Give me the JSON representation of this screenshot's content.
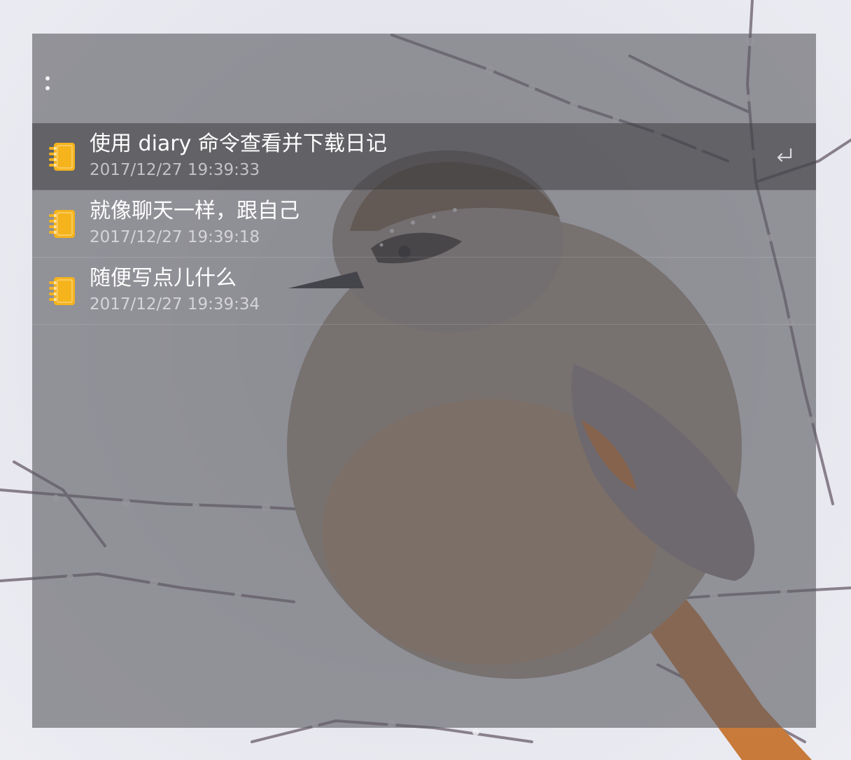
{
  "app": {
    "menu_icon": "vertical-ellipsis-icon",
    "accent_color": "#f5b31c",
    "panel_color": "#5c5c62"
  },
  "diary": {
    "entries": [
      {
        "title": "使用 diary 命令查看并下载日记",
        "timestamp": "2017/12/27 19:39:33",
        "icon": "notebook-icon",
        "selected": true,
        "action_icon": "return-key-icon"
      },
      {
        "title": "就像聊天一样，跟自己",
        "timestamp": "2017/12/27 19:39:18",
        "icon": "notebook-icon",
        "selected": false
      },
      {
        "title": "随便写点儿什么",
        "timestamp": "2017/12/27 19:39:34",
        "icon": "notebook-icon",
        "selected": false
      }
    ]
  }
}
